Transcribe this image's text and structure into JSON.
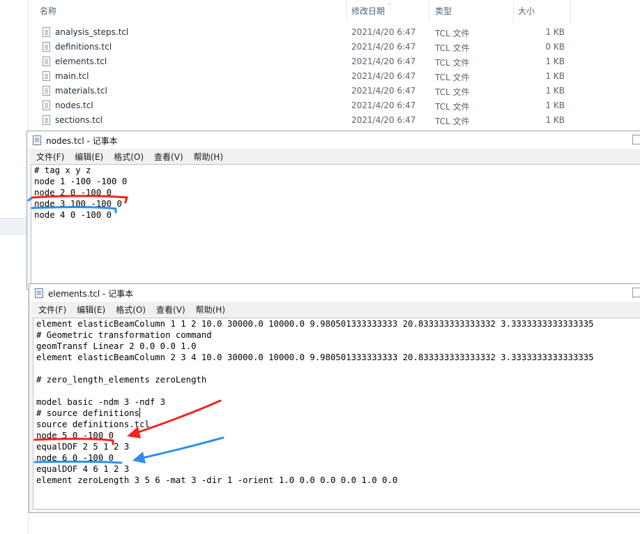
{
  "explorer": {
    "columns": {
      "name": "名称",
      "date": "修改日期",
      "type": "类型",
      "size": "大小"
    },
    "files": [
      {
        "name": "analysis_steps.tcl",
        "date": "2021/4/20 6:47",
        "type": "TCL 文件",
        "size": "1 KB"
      },
      {
        "name": "definitions.tcl",
        "date": "2021/4/20 6:47",
        "type": "TCL 文件",
        "size": "0 KB"
      },
      {
        "name": "elements.tcl",
        "date": "2021/4/20 6:47",
        "type": "TCL 文件",
        "size": "1 KB"
      },
      {
        "name": "main.tcl",
        "date": "2021/4/20 6:47",
        "type": "TCL 文件",
        "size": "1 KB"
      },
      {
        "name": "materials.tcl",
        "date": "2021/4/20 6:47",
        "type": "TCL 文件",
        "size": "1 KB"
      },
      {
        "name": "nodes.tcl",
        "date": "2021/4/20 6:47",
        "type": "TCL 文件",
        "size": "1 KB"
      },
      {
        "name": "sections.tcl",
        "date": "2021/4/20 6:47",
        "type": "TCL 文件",
        "size": "1 KB"
      }
    ]
  },
  "notepad_nodes": {
    "title": "nodes.tcl - 记事本",
    "menu": [
      "文件(F)",
      "编辑(E)",
      "格式(O)",
      "查看(V)",
      "帮助(H)"
    ],
    "lines": [
      "# tag x y z",
      "node 1 -100 -100 0",
      "node 2 0 -100 0",
      "node 3 100 -100 0",
      "node 4 0 -100 0"
    ]
  },
  "notepad_elements": {
    "title": "elements.tcl - 记事本",
    "menu": [
      "文件(F)",
      "编辑(E)",
      "格式(O)",
      "查看(V)",
      "帮助(H)"
    ],
    "lines": [
      "element elasticBeamColumn 1 1 2 10.0 30000.0 10000.0 9.980501333333333 20.833333333333332 3.3333333333333335",
      "# Geometric transformation command",
      "geomTransf Linear 2 0.0 0.0 1.0",
      "element elasticBeamColumn 2 3 4 10.0 30000.0 10000.0 9.980501333333333 20.833333333333332 3.3333333333333335",
      "",
      "# zero_length_elements zeroLength",
      "",
      "model basic -ndm 3 -ndf 3",
      "# source definitions",
      "source definitions.tcl",
      "node 5 0 -100 0",
      "equalDOF 2 5 1 2 3",
      "node 6 0 -100 0",
      "equalDOF 4 6 1 2 3",
      "element zeroLength 3 5 6 -mat 3 -dir 1 -orient 1.0 0.0 0.0 0.0 1.0 0.0"
    ]
  },
  "annotation_colors": {
    "red": "#f4231b",
    "blue": "#2b8fe8"
  }
}
